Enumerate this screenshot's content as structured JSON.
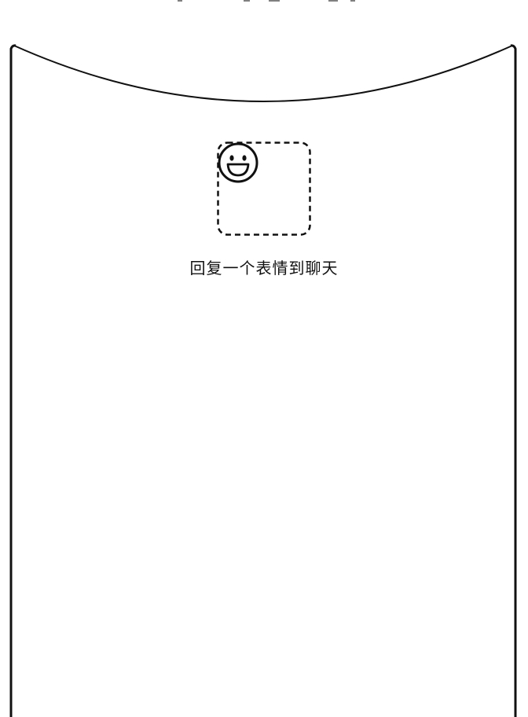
{
  "prompt": {
    "text": "回复一个表情到聊天"
  },
  "emoji_target": {
    "icon": "smiley-face-icon"
  }
}
